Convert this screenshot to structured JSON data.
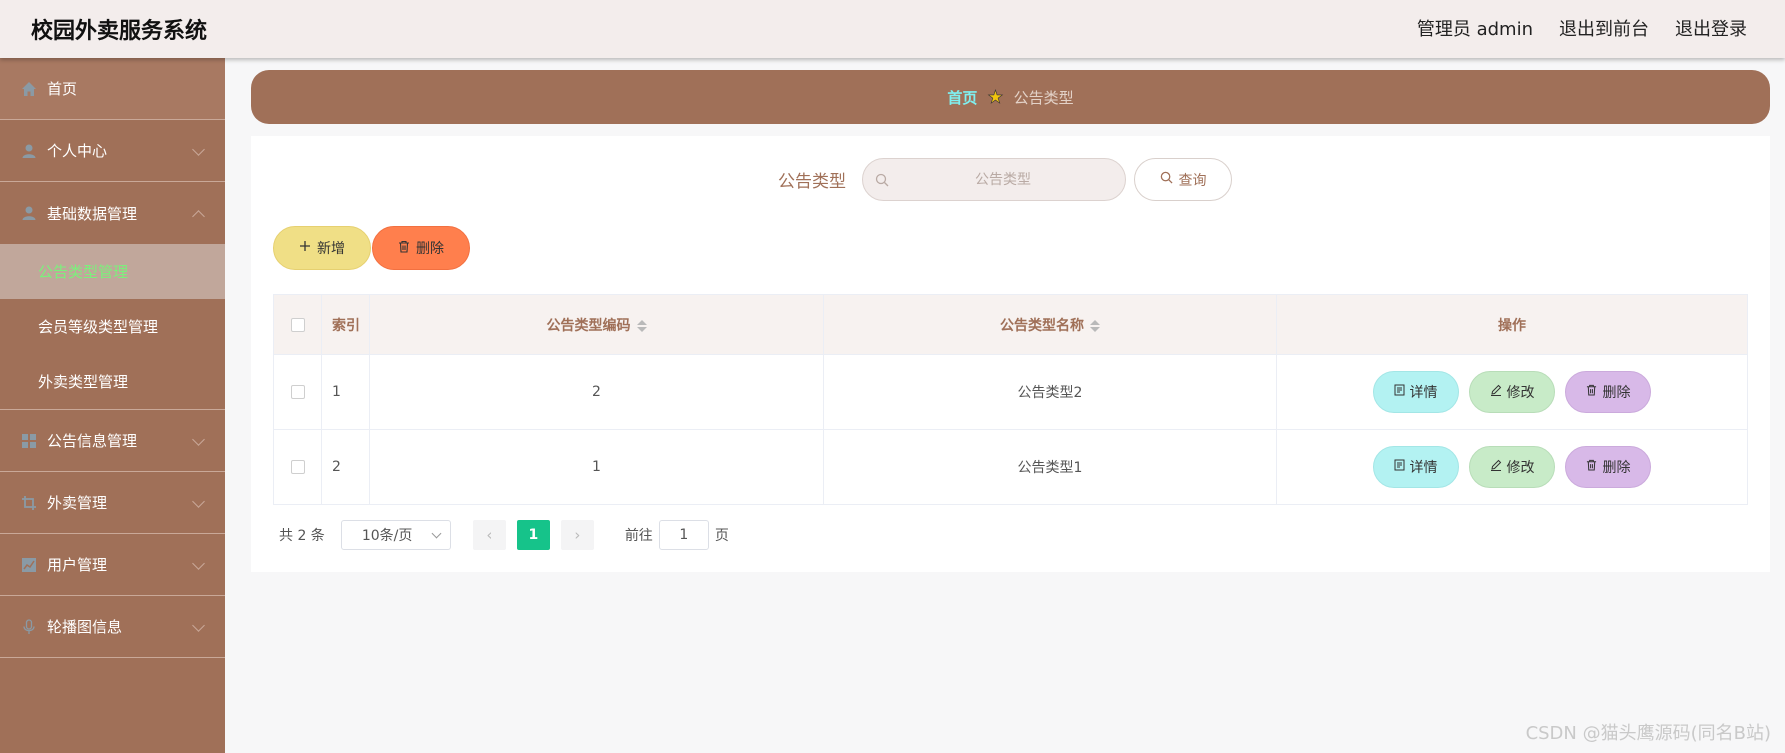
{
  "header": {
    "title": "校园外卖服务系统",
    "user": "管理员 admin",
    "front": "退出到前台",
    "logout": "退出登录"
  },
  "sidebar": {
    "home": "首页",
    "personal": "个人中心",
    "basic": "基础数据管理",
    "basic_subs": [
      "公告类型管理",
      "会员等级类型管理",
      "外卖类型管理"
    ],
    "notice": "公告信息管理",
    "takeout": "外卖管理",
    "users": "用户管理",
    "carousel": "轮播图信息"
  },
  "breadcrumb": {
    "home": "首页",
    "current": "公告类型"
  },
  "search": {
    "label": "公告类型",
    "placeholder": "公告类型",
    "button": "查询"
  },
  "actions": {
    "add": "新增",
    "delete": "删除"
  },
  "table": {
    "headers": {
      "index": "索引",
      "code": "公告类型编码",
      "name": "公告类型名称",
      "ops": "操作"
    },
    "rows": [
      {
        "index": "1",
        "code": "2",
        "name": "公告类型2"
      },
      {
        "index": "2",
        "code": "1",
        "name": "公告类型1"
      }
    ],
    "ops": {
      "detail": "详情",
      "edit": "修改",
      "delete": "删除"
    }
  },
  "pager": {
    "total": "共 2 条",
    "page_size": "10条/页",
    "current": "1",
    "goto_prefix": "前往",
    "goto_value": "1",
    "goto_suffix": "页"
  },
  "watermark": "CSDN @猫头鹰源码(同名B站)",
  "colors": {
    "accent": "#a07058",
    "active_menu_text": "#7cf07c",
    "current_page": "#16c38a"
  }
}
